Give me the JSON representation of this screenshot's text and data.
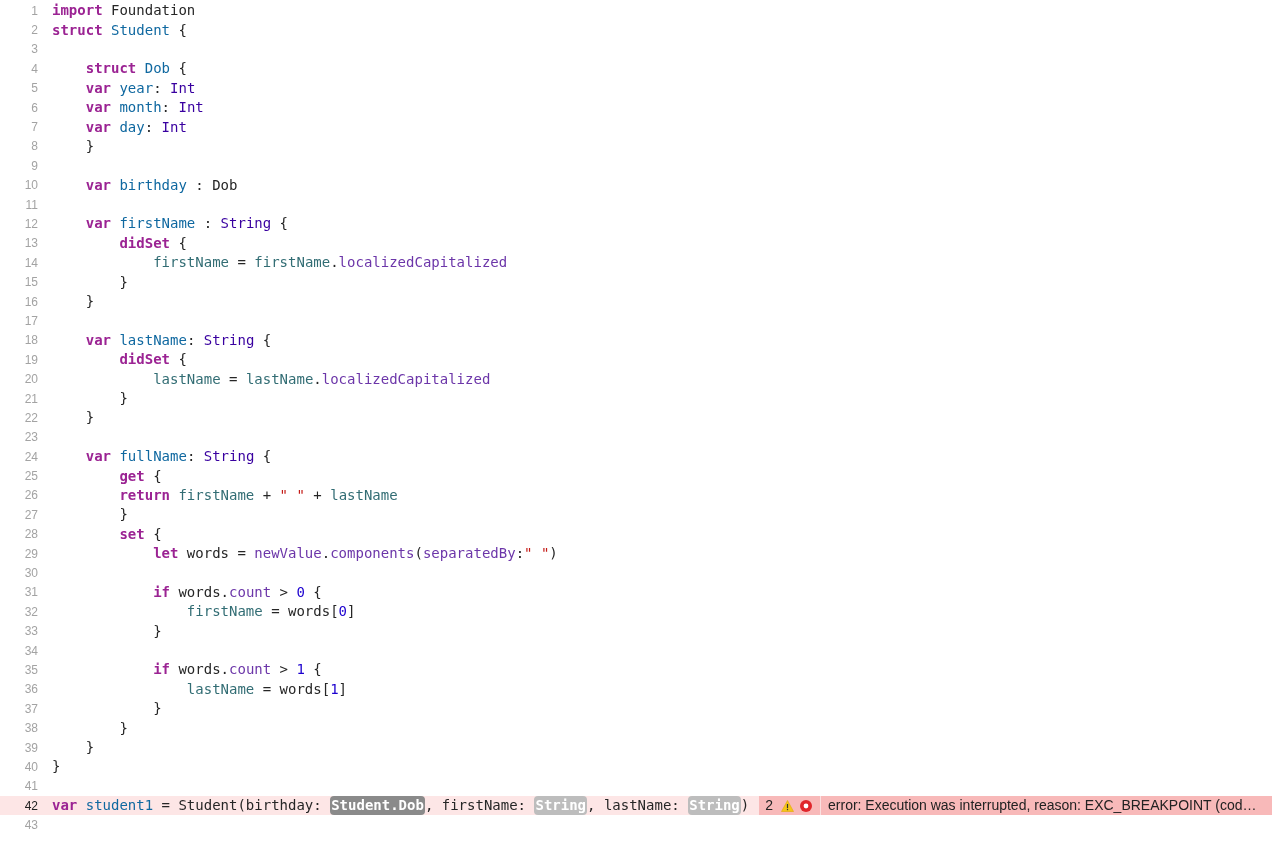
{
  "lines": [
    {
      "number": "1",
      "tokens": [
        {
          "kind": "keyword",
          "text": "import"
        },
        {
          "kind": "plain",
          "text": " Foundation"
        }
      ]
    },
    {
      "number": "2",
      "tokens": [
        {
          "kind": "keyword",
          "text": "struct"
        },
        {
          "kind": "declaration",
          "text": " Student"
        },
        {
          "kind": "plain",
          "text": " {"
        }
      ]
    },
    {
      "number": "3"
    },
    {
      "number": "4",
      "tokens": [
        {
          "kind": "keyword",
          "text": "    struct"
        },
        {
          "kind": "declaration",
          "text": " Dob"
        },
        {
          "kind": "plain",
          "text": " {"
        }
      ]
    },
    {
      "number": "5",
      "tokens": [
        {
          "kind": "keyword",
          "text": "    var"
        },
        {
          "kind": "declaration",
          "text": " year"
        },
        {
          "kind": "plain",
          "text": ": "
        },
        {
          "kind": "type",
          "text": "Int"
        }
      ]
    },
    {
      "number": "6",
      "tokens": [
        {
          "kind": "keyword",
          "text": "    var"
        },
        {
          "kind": "declaration",
          "text": " month"
        },
        {
          "kind": "plain",
          "text": ": "
        },
        {
          "kind": "type",
          "text": "Int"
        }
      ]
    },
    {
      "number": "7",
      "tokens": [
        {
          "kind": "keyword",
          "text": "    var"
        },
        {
          "kind": "declaration",
          "text": " day"
        },
        {
          "kind": "plain",
          "text": ": "
        },
        {
          "kind": "type",
          "text": "Int"
        }
      ]
    },
    {
      "number": "8",
      "tokens": [
        {
          "kind": "plain",
          "text": "    }"
        }
      ]
    },
    {
      "number": "9"
    },
    {
      "number": "10",
      "tokens": [
        {
          "kind": "keyword",
          "text": "    var"
        },
        {
          "kind": "declaration",
          "text": " birthday"
        },
        {
          "kind": "plain",
          "text": " : Dob"
        }
      ]
    },
    {
      "number": "11"
    },
    {
      "number": "12",
      "tokens": [
        {
          "kind": "keyword",
          "text": "    var"
        },
        {
          "kind": "declaration",
          "text": " firstName"
        },
        {
          "kind": "plain",
          "text": " : "
        },
        {
          "kind": "type",
          "text": "String"
        },
        {
          "kind": "plain",
          "text": " {"
        }
      ]
    },
    {
      "number": "13",
      "tokens": [
        {
          "kind": "keyword",
          "text": "        didSet"
        },
        {
          "kind": "plain",
          "text": " {"
        }
      ]
    },
    {
      "number": "14",
      "tokens": [
        {
          "kind": "property",
          "text": "            firstName"
        },
        {
          "kind": "plain",
          "text": " = "
        },
        {
          "kind": "property",
          "text": "firstName"
        },
        {
          "kind": "plain",
          "text": "."
        },
        {
          "kind": "system",
          "text": "localizedCapitalized"
        }
      ]
    },
    {
      "number": "15",
      "tokens": [
        {
          "kind": "plain",
          "text": "        }"
        }
      ]
    },
    {
      "number": "16",
      "tokens": [
        {
          "kind": "plain",
          "text": "    }"
        }
      ]
    },
    {
      "number": "17"
    },
    {
      "number": "18",
      "tokens": [
        {
          "kind": "keyword",
          "text": "    var"
        },
        {
          "kind": "declaration",
          "text": " lastName"
        },
        {
          "kind": "plain",
          "text": ": "
        },
        {
          "kind": "type",
          "text": "String"
        },
        {
          "kind": "plain",
          "text": " {"
        }
      ]
    },
    {
      "number": "19",
      "tokens": [
        {
          "kind": "keyword",
          "text": "        didSet"
        },
        {
          "kind": "plain",
          "text": " {"
        }
      ]
    },
    {
      "number": "20",
      "tokens": [
        {
          "kind": "property",
          "text": "            lastName"
        },
        {
          "kind": "plain",
          "text": " = "
        },
        {
          "kind": "property",
          "text": "lastName"
        },
        {
          "kind": "plain",
          "text": "."
        },
        {
          "kind": "system",
          "text": "localizedCapitalized"
        }
      ]
    },
    {
      "number": "21",
      "tokens": [
        {
          "kind": "plain",
          "text": "        }"
        }
      ]
    },
    {
      "number": "22",
      "tokens": [
        {
          "kind": "plain",
          "text": "    }"
        }
      ]
    },
    {
      "number": "23"
    },
    {
      "number": "24",
      "tokens": [
        {
          "kind": "keyword",
          "text": "    var"
        },
        {
          "kind": "declaration",
          "text": " fullName"
        },
        {
          "kind": "plain",
          "text": ": "
        },
        {
          "kind": "type",
          "text": "String"
        },
        {
          "kind": "plain",
          "text": " {"
        }
      ]
    },
    {
      "number": "25",
      "tokens": [
        {
          "kind": "keyword",
          "text": "        get"
        },
        {
          "kind": "plain",
          "text": " {"
        }
      ]
    },
    {
      "number": "26",
      "tokens": [
        {
          "kind": "keyword",
          "text": "        return"
        },
        {
          "kind": "property",
          "text": " firstName"
        },
        {
          "kind": "plain",
          "text": " + "
        },
        {
          "kind": "string",
          "text": "\" \""
        },
        {
          "kind": "plain",
          "text": " + "
        },
        {
          "kind": "property",
          "text": "lastName"
        }
      ]
    },
    {
      "number": "27",
      "tokens": [
        {
          "kind": "plain",
          "text": "        }"
        }
      ]
    },
    {
      "number": "28",
      "tokens": [
        {
          "kind": "keyword",
          "text": "        set"
        },
        {
          "kind": "plain",
          "text": " {"
        }
      ]
    },
    {
      "number": "29",
      "tokens": [
        {
          "kind": "keyword",
          "text": "            let"
        },
        {
          "kind": "plain",
          "text": " words = "
        },
        {
          "kind": "system",
          "text": "newValue"
        },
        {
          "kind": "plain",
          "text": "."
        },
        {
          "kind": "system",
          "text": "components"
        },
        {
          "kind": "plain",
          "text": "("
        },
        {
          "kind": "system",
          "text": "separatedBy"
        },
        {
          "kind": "plain",
          "text": ":"
        },
        {
          "kind": "string",
          "text": "\" \""
        },
        {
          "kind": "plain",
          "text": ")"
        }
      ]
    },
    {
      "number": "30"
    },
    {
      "number": "31",
      "tokens": [
        {
          "kind": "keyword",
          "text": "            if"
        },
        {
          "kind": "plain",
          "text": " words."
        },
        {
          "kind": "system",
          "text": "count"
        },
        {
          "kind": "plain",
          "text": " > "
        },
        {
          "kind": "number",
          "text": "0"
        },
        {
          "kind": "plain",
          "text": " {"
        }
      ]
    },
    {
      "number": "32",
      "tokens": [
        {
          "kind": "property",
          "text": "                firstName"
        },
        {
          "kind": "plain",
          "text": " = words["
        },
        {
          "kind": "number",
          "text": "0"
        },
        {
          "kind": "plain",
          "text": "]"
        }
      ]
    },
    {
      "number": "33",
      "tokens": [
        {
          "kind": "plain",
          "text": "            }"
        }
      ]
    },
    {
      "number": "34"
    },
    {
      "number": "35",
      "tokens": [
        {
          "kind": "keyword",
          "text": "            if"
        },
        {
          "kind": "plain",
          "text": " words."
        },
        {
          "kind": "system",
          "text": "count"
        },
        {
          "kind": "plain",
          "text": " > "
        },
        {
          "kind": "number",
          "text": "1"
        },
        {
          "kind": "plain",
          "text": " {"
        }
      ]
    },
    {
      "number": "36",
      "tokens": [
        {
          "kind": "property",
          "text": "                lastName"
        },
        {
          "kind": "plain",
          "text": " = words["
        },
        {
          "kind": "number",
          "text": "1"
        },
        {
          "kind": "plain",
          "text": "]"
        }
      ]
    },
    {
      "number": "37",
      "tokens": [
        {
          "kind": "plain",
          "text": "            }"
        }
      ]
    },
    {
      "number": "38",
      "tokens": [
        {
          "kind": "plain",
          "text": "        }"
        }
      ]
    },
    {
      "number": "39",
      "tokens": [
        {
          "kind": "plain",
          "text": "    }"
        }
      ]
    },
    {
      "number": "40",
      "tokens": [
        {
          "kind": "plain",
          "text": "}"
        }
      ]
    },
    {
      "number": "41"
    },
    {
      "number": "42",
      "highlighted": true,
      "tokens": [
        {
          "kind": "keyword",
          "text": "var"
        },
        {
          "kind": "declaration",
          "text": " student1"
        },
        {
          "kind": "plain",
          "text": " = Student(birthday: "
        },
        {
          "kind": "placeholder",
          "text": "Student.Dob",
          "selected": true
        },
        {
          "kind": "plain",
          "text": ", firstName: "
        },
        {
          "kind": "placeholder",
          "text": "String",
          "selected": false
        },
        {
          "kind": "plain",
          "text": ", lastName: "
        },
        {
          "kind": "placeholder",
          "text": "String",
          "selected": false
        },
        {
          "kind": "plain",
          "text": ")"
        }
      ],
      "error": {
        "count": "2",
        "message": "error: Execution was interrupted, reason: EXC_BREAKPOINT (cod…"
      }
    },
    {
      "number": "43"
    }
  ]
}
